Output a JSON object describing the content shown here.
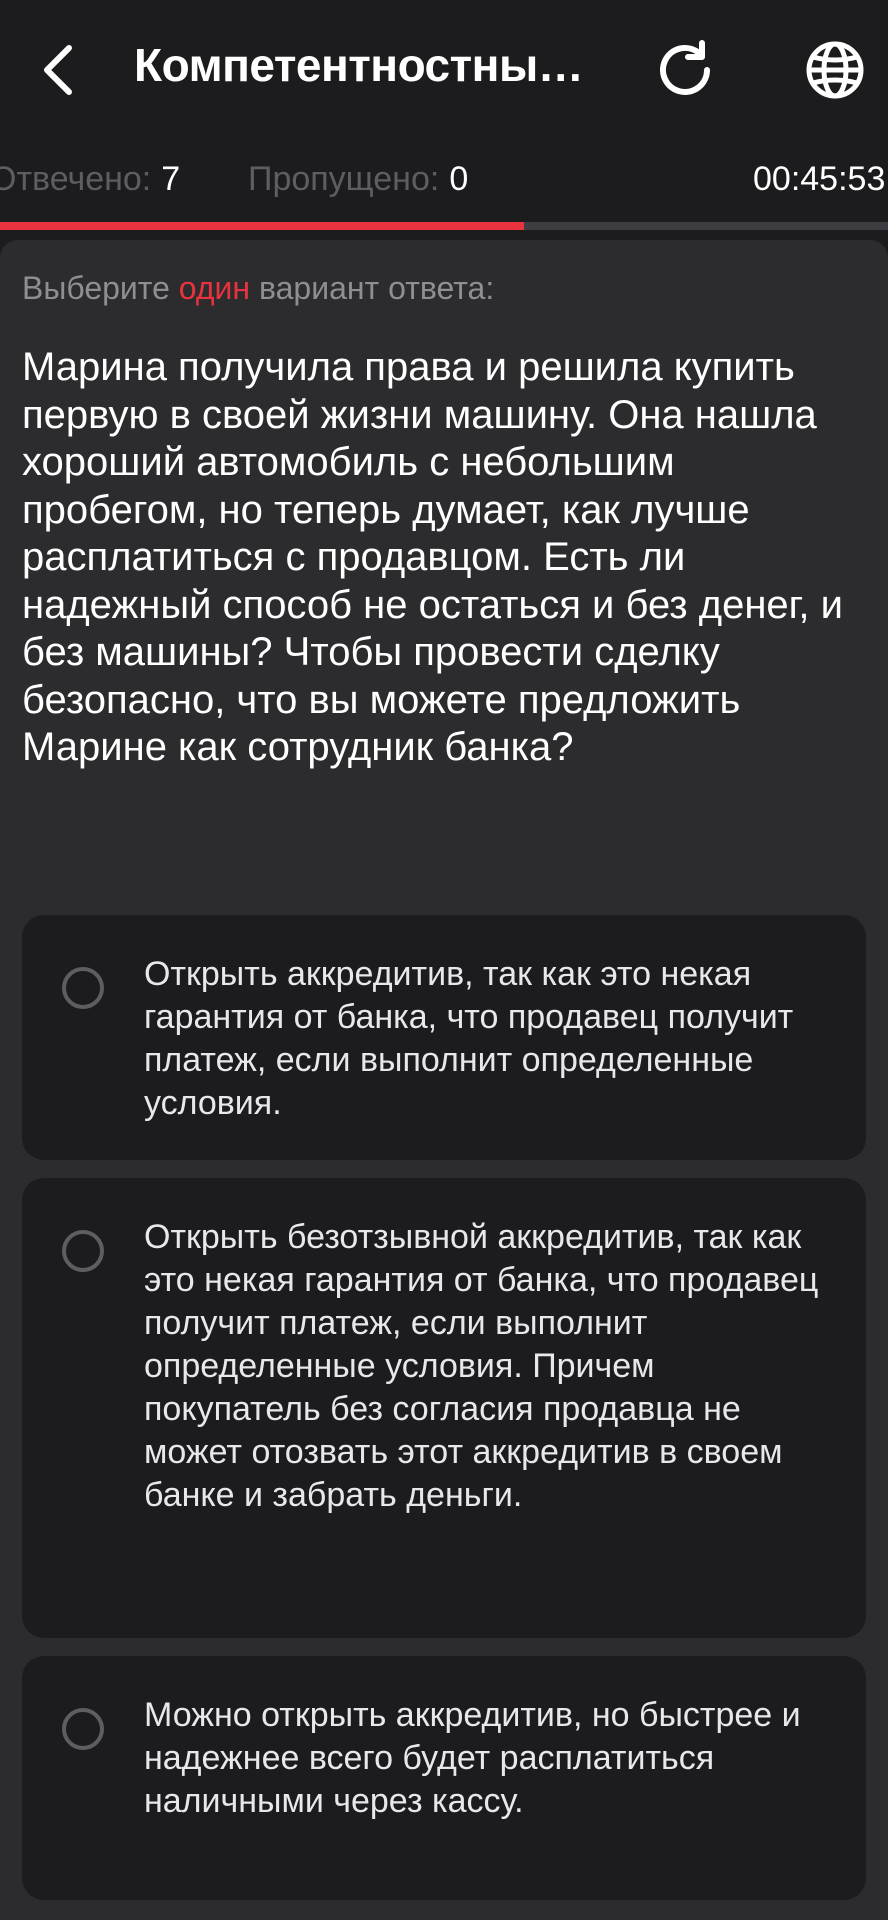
{
  "header": {
    "title": "Компетентностны…",
    "back_icon": "chevron-left-icon",
    "refresh_icon": "refresh-icon",
    "globe_icon": "globe-icon"
  },
  "stats": {
    "answered_label": "Отвечено:",
    "answered_value": "7",
    "skipped_label": "Пропущено:",
    "skipped_value": "0",
    "timer": "00:45:53"
  },
  "progress": {
    "fraction": 0.59,
    "fill_color": "#e8333f",
    "track_color": "#3e3e42"
  },
  "question": {
    "instruction_before": "Выберите",
    "instruction_accent": "один",
    "instruction_after": "вариант ответа:",
    "text": "Марина получила права и решила купить первую в своей жизни машину. Она нашла хороший автомобиль с небольшим пробегом, но теперь думает, как лучше расплатиться с продавцом. Есть ли надежный способ не остаться и без денег, и без машины? Чтобы провести сделку безопасно, что вы можете предложить Марине как сотрудник банка?",
    "options": [
      {
        "text": "Открыть аккредитив, так как это некая гарантия от банка, что продавец получит платеж, если выполнит определенные условия."
      },
      {
        "text": "Открыть безотзывной аккредитив, так как это некая гарантия от банка, что продавец получит платеж, если выполнит определенные условия. Причем покупатель без согласия продавца не может отозвать этот аккредитив в своем банке и забрать деньги."
      },
      {
        "text": "Можно открыть аккредитив, но быстрее и надежнее всего будет расплатиться наличными через кассу."
      }
    ]
  },
  "colors": {
    "background": "#1c1c1e",
    "card": "#2c2c2e",
    "accent": "#e8333f",
    "muted_text": "#8e8e93"
  }
}
